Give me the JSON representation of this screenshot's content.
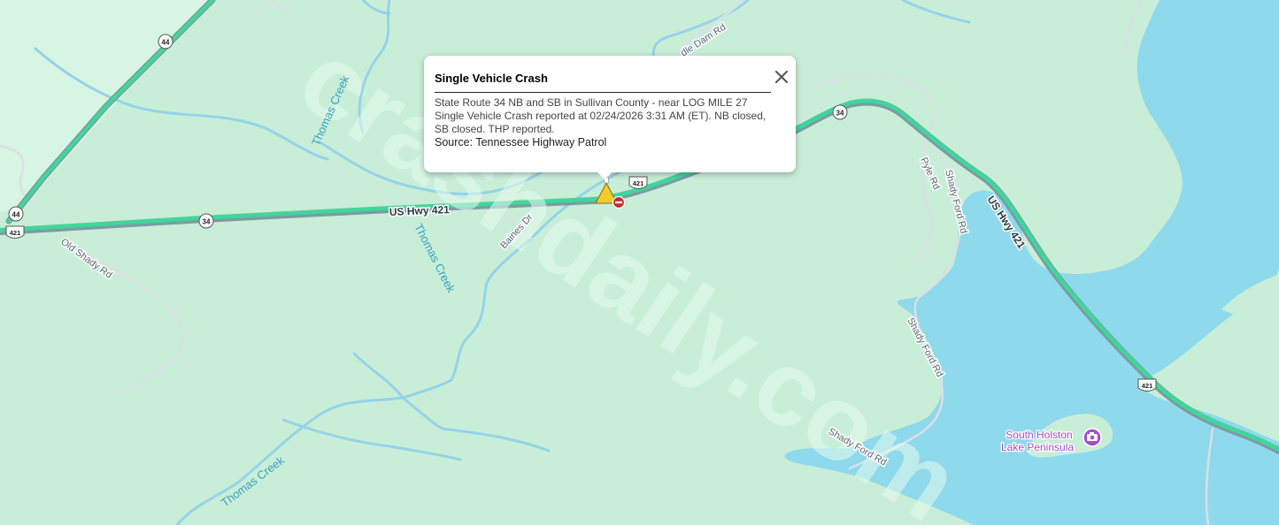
{
  "popup": {
    "title": "Single Vehicle Crash",
    "line1": "State Route 34 NB and SB in Sullivan County - near LOG MILE 27",
    "line2": "Single Vehicle Crash reported at 02/24/2026 3:31 AM (ET). NB closed, SB closed. THP reported.",
    "source": "Source: Tennessee Highway Patrol",
    "close_icon": "close-icon"
  },
  "map": {
    "colors": {
      "land": "#c8eed8",
      "water": "#8fd9ec",
      "stream": "#94d3e9",
      "highway_fill": "#3cd89a",
      "highway_casing": "#7e9aa4",
      "minor_road": "#dcdfe6",
      "poi": "#a24fc9"
    },
    "road_labels": {
      "us_hwy_421_main": "US Hwy 421",
      "us_hwy_421_east": "US Hwy 421",
      "old_shady_rd": "Old Shady Rd",
      "baines_dr": "Baines Dr",
      "pyle_rd": "Pyle Rd",
      "shady_ford_rd_1": "Shady Ford Rd",
      "shady_ford_rd_2": "Shady Ford Rd",
      "shady_ford_rd_3": "Shady Ford Rd",
      "dam_rd": "dle Dam Rd"
    },
    "water_labels": {
      "thomas_creek_1": "Thomas Creek",
      "thomas_creek_2": "Thomas Creek",
      "thomas_creek_3": "Thomas Creek"
    },
    "shields": {
      "sr44_top": "44",
      "sr44_left": "44",
      "us421_left": "421",
      "sr34_center": "34",
      "us421_center": "421",
      "sr34_right": "34",
      "us421_right": "421"
    },
    "poi": {
      "name_line1": "South Holston",
      "name_line2": "Lake Peninsula",
      "icon": "camera-icon"
    },
    "markers": {
      "incident_icon": "warning-triangle-icon",
      "closure_icon": "road-closed-icon"
    },
    "watermark": "crashdaily.com"
  }
}
